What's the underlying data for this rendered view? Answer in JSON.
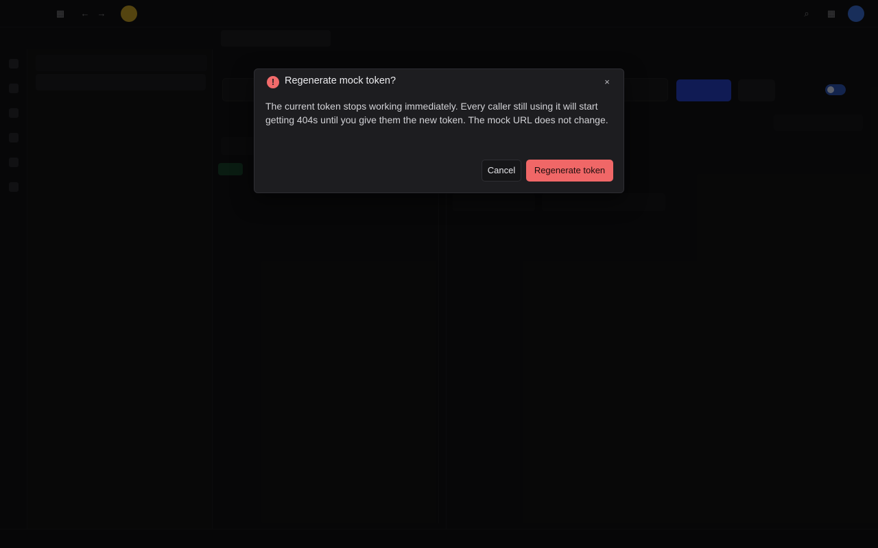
{
  "dialog": {
    "title": "Regenerate mock token?",
    "body": "The current token stops working immediately. Every caller still using it will start getting 404s until you give them the new token. The mock URL does not change.",
    "cancel_label": "Cancel",
    "confirm_label": "Regenerate token",
    "close_glyph": "×",
    "alert_glyph": "!",
    "alert_icon": "alert-circle-icon",
    "danger_color": "#f06767"
  },
  "colors": {
    "background": "#121214",
    "accent": "#2741c9",
    "avatar": "#3b6fd6",
    "logo": "#c9a227"
  }
}
